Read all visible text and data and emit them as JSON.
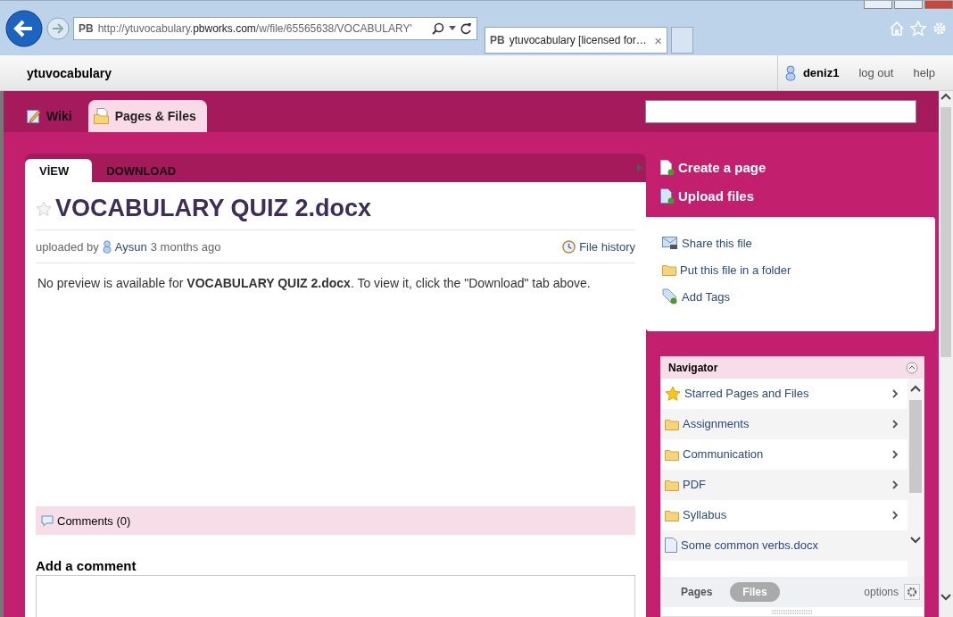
{
  "browser": {
    "url": "http://ytuvocabulary.**pbworks.com**/w/file/65565638/VOCABULARY'",
    "url_favicon": "PB",
    "tab_favicon": "PB",
    "tab_title": "ytuvocabulary [licensed for…",
    "tab_close": "×"
  },
  "site": {
    "title": "ytuvocabulary",
    "user": "deniz1",
    "links": [
      "log out",
      "help"
    ]
  },
  "nav_tabs": [
    {
      "label": "Wiki",
      "kind": "wiki",
      "selected": false
    },
    {
      "label": "Pages & Files",
      "kind": "files",
      "selected": true
    }
  ],
  "content_tabs": [
    {
      "label": "VİEW",
      "selected": true
    },
    {
      "label": "DOWNLOAD",
      "selected": false
    }
  ],
  "file": {
    "title": "VOCABULARY QUIZ 2.docx",
    "uploaded_prefix": "uploaded by",
    "uploader": "Aysun",
    "age": "3 months ago",
    "history": "File history",
    "message": "No preview is available for **VOCABULARY QUIZ 2.docx**. To view it, click the \"Download\" tab above."
  },
  "comments": {
    "label": "Comments (0)",
    "add_label": "Add a comment"
  },
  "actions": [
    {
      "label": "Create a page",
      "kind": "page"
    },
    {
      "label": "Upload files",
      "kind": "upload"
    }
  ],
  "file_actions": [
    {
      "label": "Share this file",
      "kind": "share"
    },
    {
      "label": "Put this file in a folder",
      "kind": "folder"
    },
    {
      "label": "Add Tags",
      "kind": "tag"
    }
  ],
  "navigator": {
    "title": "Navigator",
    "items": [
      {
        "label": "Starred Pages and Files",
        "kind": "star",
        "expandable": true
      },
      {
        "label": "Assignments",
        "kind": "folder",
        "expandable": true
      },
      {
        "label": "Communication",
        "kind": "folder",
        "expandable": true
      },
      {
        "label": "PDF",
        "kind": "folder",
        "expandable": true
      },
      {
        "label": "Syllabus",
        "kind": "folder",
        "expandable": true
      },
      {
        "label": "Some common verbs.docx",
        "kind": "doc",
        "expandable": false
      }
    ],
    "tabs": [
      {
        "label": "Pages",
        "selected": false
      },
      {
        "label": "Files",
        "selected": true
      }
    ],
    "options": "options"
  }
}
